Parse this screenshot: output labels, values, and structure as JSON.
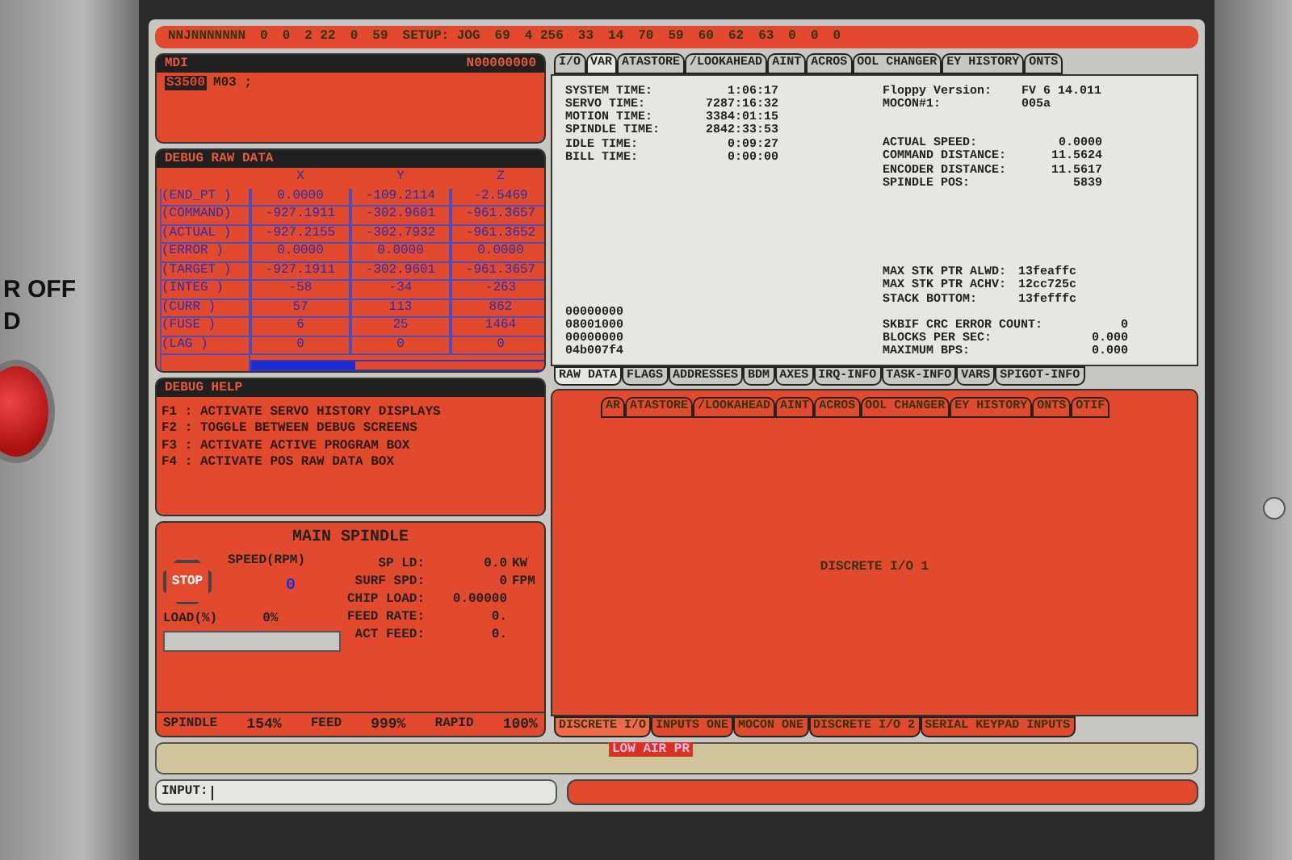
{
  "bezel": {
    "labels": [
      "R OFF",
      "D"
    ]
  },
  "status_bar": {
    "items": [
      "NNJNNNNNNN",
      "0",
      "0",
      "2 22",
      "0",
      "59",
      "SETUP: JOG",
      "69",
      "4 256",
      "33",
      "14",
      "70",
      "59",
      "60",
      "62",
      "63",
      "0",
      "0",
      "0"
    ]
  },
  "mdi": {
    "title": "MDI",
    "code": "N00000000",
    "tokens": [
      {
        "text": "S3500",
        "highlighted": true
      },
      {
        "text": "M03 ;",
        "highlighted": false
      }
    ]
  },
  "raw_data": {
    "title": "DEBUG RAW DATA",
    "columns": [
      "X",
      "Y",
      "Z"
    ],
    "rows": [
      {
        "label": "(END_PT )",
        "values": [
          "0.0000",
          "-109.2114",
          "-2.5469"
        ]
      },
      {
        "label": "(COMMAND)",
        "values": [
          "-927.1911",
          "-302.9601",
          "-961.3657"
        ]
      },
      {
        "label": "(ACTUAL )",
        "values": [
          "-927.2155",
          "-302.7932",
          "-961.3652"
        ]
      },
      {
        "label": "(ERROR  )",
        "values": [
          "0.0000",
          "0.0000",
          "0.0000"
        ]
      },
      {
        "label": "(TARGET )",
        "values": [
          "-927.1911",
          "-302.9601",
          "-961.3657"
        ]
      },
      {
        "label": "(INTEG  )",
        "values": [
          "-58",
          "-34",
          "-263"
        ]
      },
      {
        "label": "(CURR   )",
        "values": [
          "57",
          "113",
          "862"
        ]
      },
      {
        "label": "(FUSE   )",
        "values": [
          "6",
          "25",
          "1464"
        ]
      },
      {
        "label": "(LAG    )",
        "values": [
          "0",
          "0",
          "0"
        ]
      }
    ]
  },
  "debug_help": {
    "title": "DEBUG HELP",
    "lines": [
      "F1 : ACTIVATE SERVO HISTORY DISPLAYS",
      "F2 : TOGGLE BETWEEN DEBUG SCREENS",
      "F3 : ACTIVATE ACTIVE PROGRAM BOX",
      "F4 : ACTIVATE POS RAW DATA BOX"
    ]
  },
  "spindle": {
    "title": "MAIN SPINDLE",
    "stop": "STOP",
    "speed_label": "SPEED(RPM)",
    "speed": "0",
    "load_label": "LOAD(%)",
    "load": "0%",
    "load_meter": {
      "level": 0
    },
    "stats": [
      {
        "label": "SP LD:",
        "value": "0.0",
        "unit": "KW"
      },
      {
        "label": "SURF SPD:",
        "value": "0",
        "unit": "FPM"
      },
      {
        "label": "CHIP LOAD:",
        "value": "0.00000"
      },
      {
        "label": "FEED RATE:",
        "value": "0."
      },
      {
        "label": "ACT FEED:",
        "value": "0."
      }
    ],
    "overrides": [
      {
        "label": "SPINDLE",
        "value": "154%"
      },
      {
        "label": "FEED",
        "value": "999%"
      },
      {
        "label": "RAPID",
        "value": "100%"
      }
    ]
  },
  "top_tabs": [
    {
      "label": "I/O",
      "selected": false
    },
    {
      "label": "VAR",
      "selected": true
    },
    {
      "label": "ATASTORE",
      "selected": false
    },
    {
      "label": "/LOOKAHEAD",
      "selected": false
    },
    {
      "label": "AINT",
      "selected": false
    },
    {
      "label": "ACROS",
      "selected": false
    },
    {
      "label": "OOL CHANGER",
      "selected": false
    },
    {
      "label": "EY HISTORY",
      "selected": false
    },
    {
      "label": "ONTS",
      "selected": false
    }
  ],
  "var_panel": {
    "times": [
      {
        "label": "SYSTEM TIME:",
        "value": "1:06:17"
      },
      {
        "label": "SERVO TIME:",
        "value": "7287:16:32"
      },
      {
        "label": "MOTION TIME:",
        "value": "3384:01:15"
      },
      {
        "label": "SPINDLE TIME:",
        "value": "2842:33:53"
      },
      {
        "label": "IDLE TIME:",
        "value": "0:09:27"
      },
      {
        "label": "BILL TIME:",
        "value": "0:00:00"
      }
    ],
    "versions": [
      {
        "label": "Floppy Version:",
        "value": "FV 6  14.011"
      },
      {
        "label": "MOCON#1:",
        "value": "005a"
      }
    ],
    "motion": [
      {
        "label": "ACTUAL SPEED:",
        "value": "0.0000"
      },
      {
        "label": "COMMAND DISTANCE:",
        "value": "11.5624"
      },
      {
        "label": "ENCODER DISTANCE:",
        "value": "11.5617"
      },
      {
        "label": "SPINDLE POS:",
        "value": "5839"
      }
    ],
    "stack": [
      {
        "label": "MAX STK PTR ALWD:",
        "value": "13feaffc"
      },
      {
        "label": "MAX STK PTR ACHV:",
        "value": "12cc725c"
      },
      {
        "label": "STACK BOTTOM:",
        "value": "13fefffc"
      }
    ],
    "hex": [
      "00000000",
      "08001000",
      "00000000",
      "04b007f4"
    ],
    "comms": [
      {
        "label": "SKBIF CRC ERROR COUNT:",
        "value": "0"
      },
      {
        "label": "BLOCKS PER SEC:",
        "value": "0.000"
      },
      {
        "label": "MAXIMUM BPS:",
        "value": "0.000"
      }
    ]
  },
  "var_tabs": [
    {
      "label": "RAW DATA",
      "selected": true
    },
    {
      "label": "FLAGS",
      "selected": false
    },
    {
      "label": "ADDRESSES",
      "selected": false
    },
    {
      "label": "BDM",
      "selected": false
    },
    {
      "label": "AXES",
      "selected": false
    },
    {
      "label": "IRQ-INFO",
      "selected": false
    },
    {
      "label": "TASK-INFO",
      "selected": false
    },
    {
      "label": "VARS",
      "selected": false
    },
    {
      "label": "SPIGOT-INFO",
      "selected": false
    }
  ],
  "io_tabs": [
    {
      "label": "AR",
      "selected": false
    },
    {
      "label": "ATASTORE",
      "selected": false
    },
    {
      "label": "/LOOKAHEAD",
      "selected": false
    },
    {
      "label": "AINT",
      "selected": false
    },
    {
      "label": "ACROS",
      "selected": false
    },
    {
      "label": "OOL CHANGER",
      "selected": false
    },
    {
      "label": "EY HISTORY",
      "selected": false
    },
    {
      "label": "ONTS",
      "selected": false
    },
    {
      "label": "OTIF",
      "selected": false
    }
  ],
  "io_panel": {
    "heading": "DISCRETE I/O 1"
  },
  "io_bottom_tabs": [
    {
      "label": "DISCRETE I/O",
      "selected": true
    },
    {
      "label": "INPUTS ONE",
      "selected": false
    },
    {
      "label": "MOCON ONE",
      "selected": false
    },
    {
      "label": "DISCRETE I/O 2",
      "selected": false
    },
    {
      "label": "SERIAL KEYPAD INPUTS",
      "selected": false
    }
  ],
  "alarm": {
    "text": "LOW AIR PR"
  },
  "input": {
    "label": "INPUT:"
  }
}
